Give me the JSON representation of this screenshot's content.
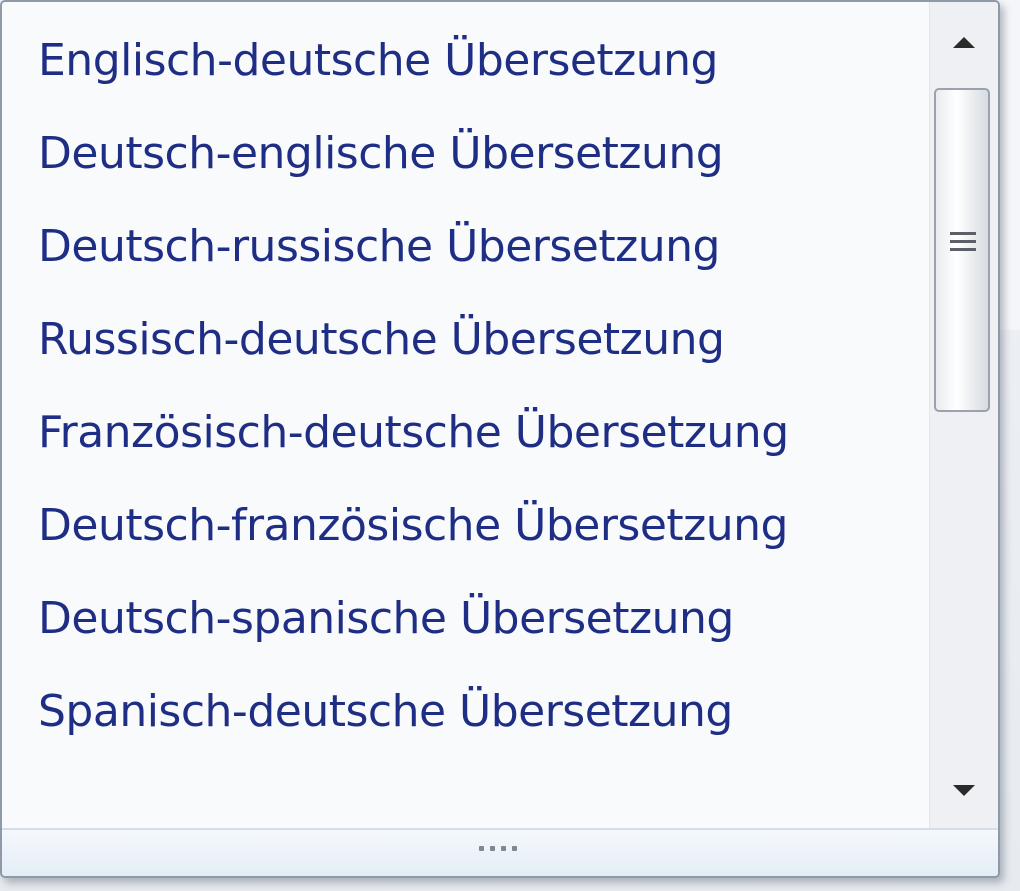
{
  "dropdown": {
    "items": [
      {
        "label": "Englisch-deutsche Übersetzung"
      },
      {
        "label": "Deutsch-englische Übersetzung"
      },
      {
        "label": "Deutsch-russische Übersetzung"
      },
      {
        "label": "Russisch-deutsche Übersetzung"
      },
      {
        "label": "Französisch-deutsche Übersetzung"
      },
      {
        "label": "Deutsch-französische Übersetzung"
      },
      {
        "label": "Deutsch-spanische Übersetzung"
      },
      {
        "label": "Spanisch-deutsche Übersetzung"
      }
    ]
  },
  "icons": {
    "scroll_up": "chevron-up-icon",
    "scroll_down": "chevron-down-icon",
    "thumb_grip": "grip-lines-icon",
    "resize": "resize-grip-icon"
  },
  "colors": {
    "item_text": "#1f2e85",
    "background": "#f9fafc",
    "border": "#8f9aa8"
  }
}
